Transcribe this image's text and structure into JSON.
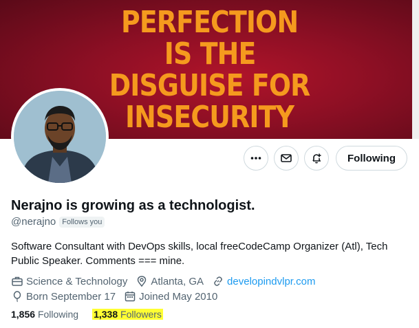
{
  "banner": {
    "lines": [
      "PERFECTION",
      "IS THE",
      "DISGUISE FOR",
      "INSECURITY"
    ],
    "bg_color": "#8c0f24",
    "text_color": "#f59a1e"
  },
  "actions": {
    "more_icon": "more-horizontal-icon",
    "message_icon": "envelope-icon",
    "notify_icon": "bell-plus-icon",
    "following_label": "Following"
  },
  "profile": {
    "display_name": "Nerajno is growing as a technologist.",
    "handle": "@nerajno",
    "follows_you": "Follows you",
    "bio": "Software Consultant with DevOps skills, local freeCodeCamp Organizer (Atl), Tech Public Speaker. Comments === mine.",
    "category": "Science & Technology",
    "location": "Atlanta, GA",
    "website": "developindvlpr.com",
    "birthday": "Born September 17",
    "joined": "Joined May 2010"
  },
  "counts": {
    "following_num": "1,856",
    "following_label": "Following",
    "followers_num": "1,338",
    "followers_label": "Followers"
  },
  "colors": {
    "link": "#1d9bf0",
    "muted": "#536471",
    "highlight": "#ffff33"
  }
}
